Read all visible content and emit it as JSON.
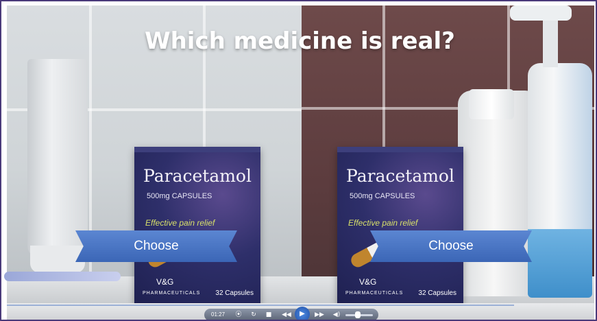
{
  "video": {
    "question": "Which medicine is real?",
    "left_box": {
      "name": "Paracetamol",
      "dose": "500mg CAPSULES",
      "tagline": "Effective pain relief",
      "brand": "V&G",
      "maker": "PHARMACEUTICALS",
      "count": "32 Capsules"
    },
    "right_box": {
      "name": "Paracetamol",
      "dose": "500mg CAPSULES",
      "tagline": "Effective pain relief",
      "brand": "V&G",
      "maker": "PHARMACEUTICALS",
      "count": "32 Capsules"
    },
    "choose_left_label": "Choose",
    "choose_right_label": "Choose"
  },
  "player": {
    "time": "01:27",
    "icons": {
      "bookmark": "⦿",
      "replay": "↻",
      "stop": "■",
      "rewind": "◀◀",
      "play": "▶",
      "forward": "▶▶",
      "volume": "◀)"
    },
    "volume_level": 0.45
  },
  "colors": {
    "ribbon": "#4a76c6",
    "box": "#2e2f6a",
    "tagline": "#d8e06a"
  }
}
